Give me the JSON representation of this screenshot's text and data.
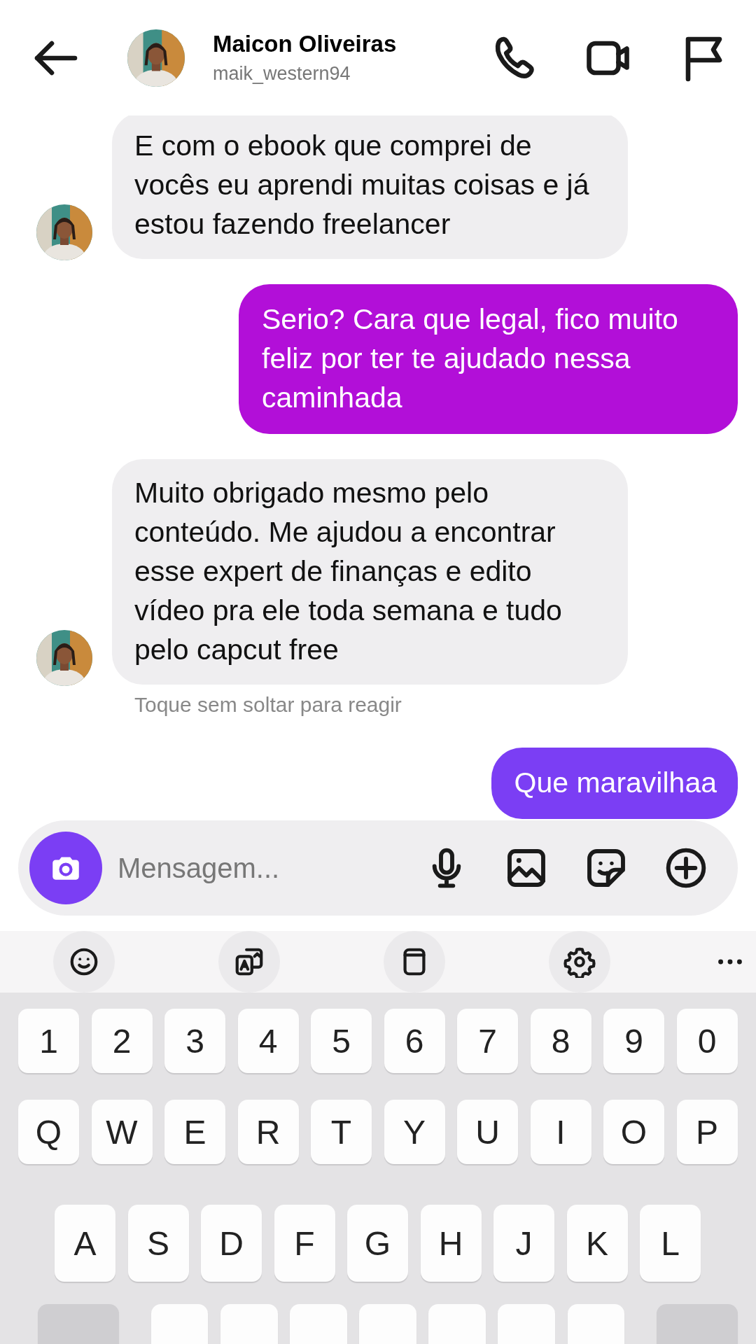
{
  "header": {
    "name": "Maicon Oliveiras",
    "username": "maik_western94"
  },
  "messages": [
    {
      "kind": "incoming",
      "text": "E com o ebook que comprei de vocês eu aprendi muitas coisas e já estou fazendo freelancer",
      "color": "#efeef0",
      "avatar": true
    },
    {
      "kind": "outgoing",
      "text": "Serio? Cara que legal, fico muito feliz por ter te ajudado nessa caminhada",
      "color": "#b20fd8"
    },
    {
      "kind": "incoming",
      "text": "Muito obrigado mesmo pelo conteúdo. Me ajudou a encontrar esse expert de finanças e edito vídeo pra ele toda semana e tudo pelo capcut free",
      "color": "#efeef0",
      "avatar": true
    },
    {
      "kind": "hint",
      "text": "Toque sem soltar para reagir"
    },
    {
      "kind": "outgoing",
      "text": "Que maravilhaa",
      "color": "#7b3ef4"
    }
  ],
  "composer": {
    "placeholder": "Mensagem..."
  },
  "keyboard": {
    "rows": [
      [
        "1",
        "2",
        "3",
        "4",
        "5",
        "6",
        "7",
        "8",
        "9",
        "0"
      ],
      [
        "Q",
        "W",
        "E",
        "R",
        "T",
        "Y",
        "U",
        "I",
        "O",
        "P"
      ],
      [
        "A",
        "S",
        "D",
        "F",
        "G",
        "H",
        "J",
        "K",
        "L"
      ]
    ],
    "partial_row": [
      {
        "kind": "function"
      },
      {
        "kind": "letter"
      },
      {
        "kind": "letter"
      },
      {
        "kind": "letter"
      },
      {
        "kind": "letter"
      },
      {
        "kind": "letter"
      },
      {
        "kind": "letter"
      },
      {
        "kind": "letter"
      },
      {
        "kind": "function"
      }
    ]
  }
}
